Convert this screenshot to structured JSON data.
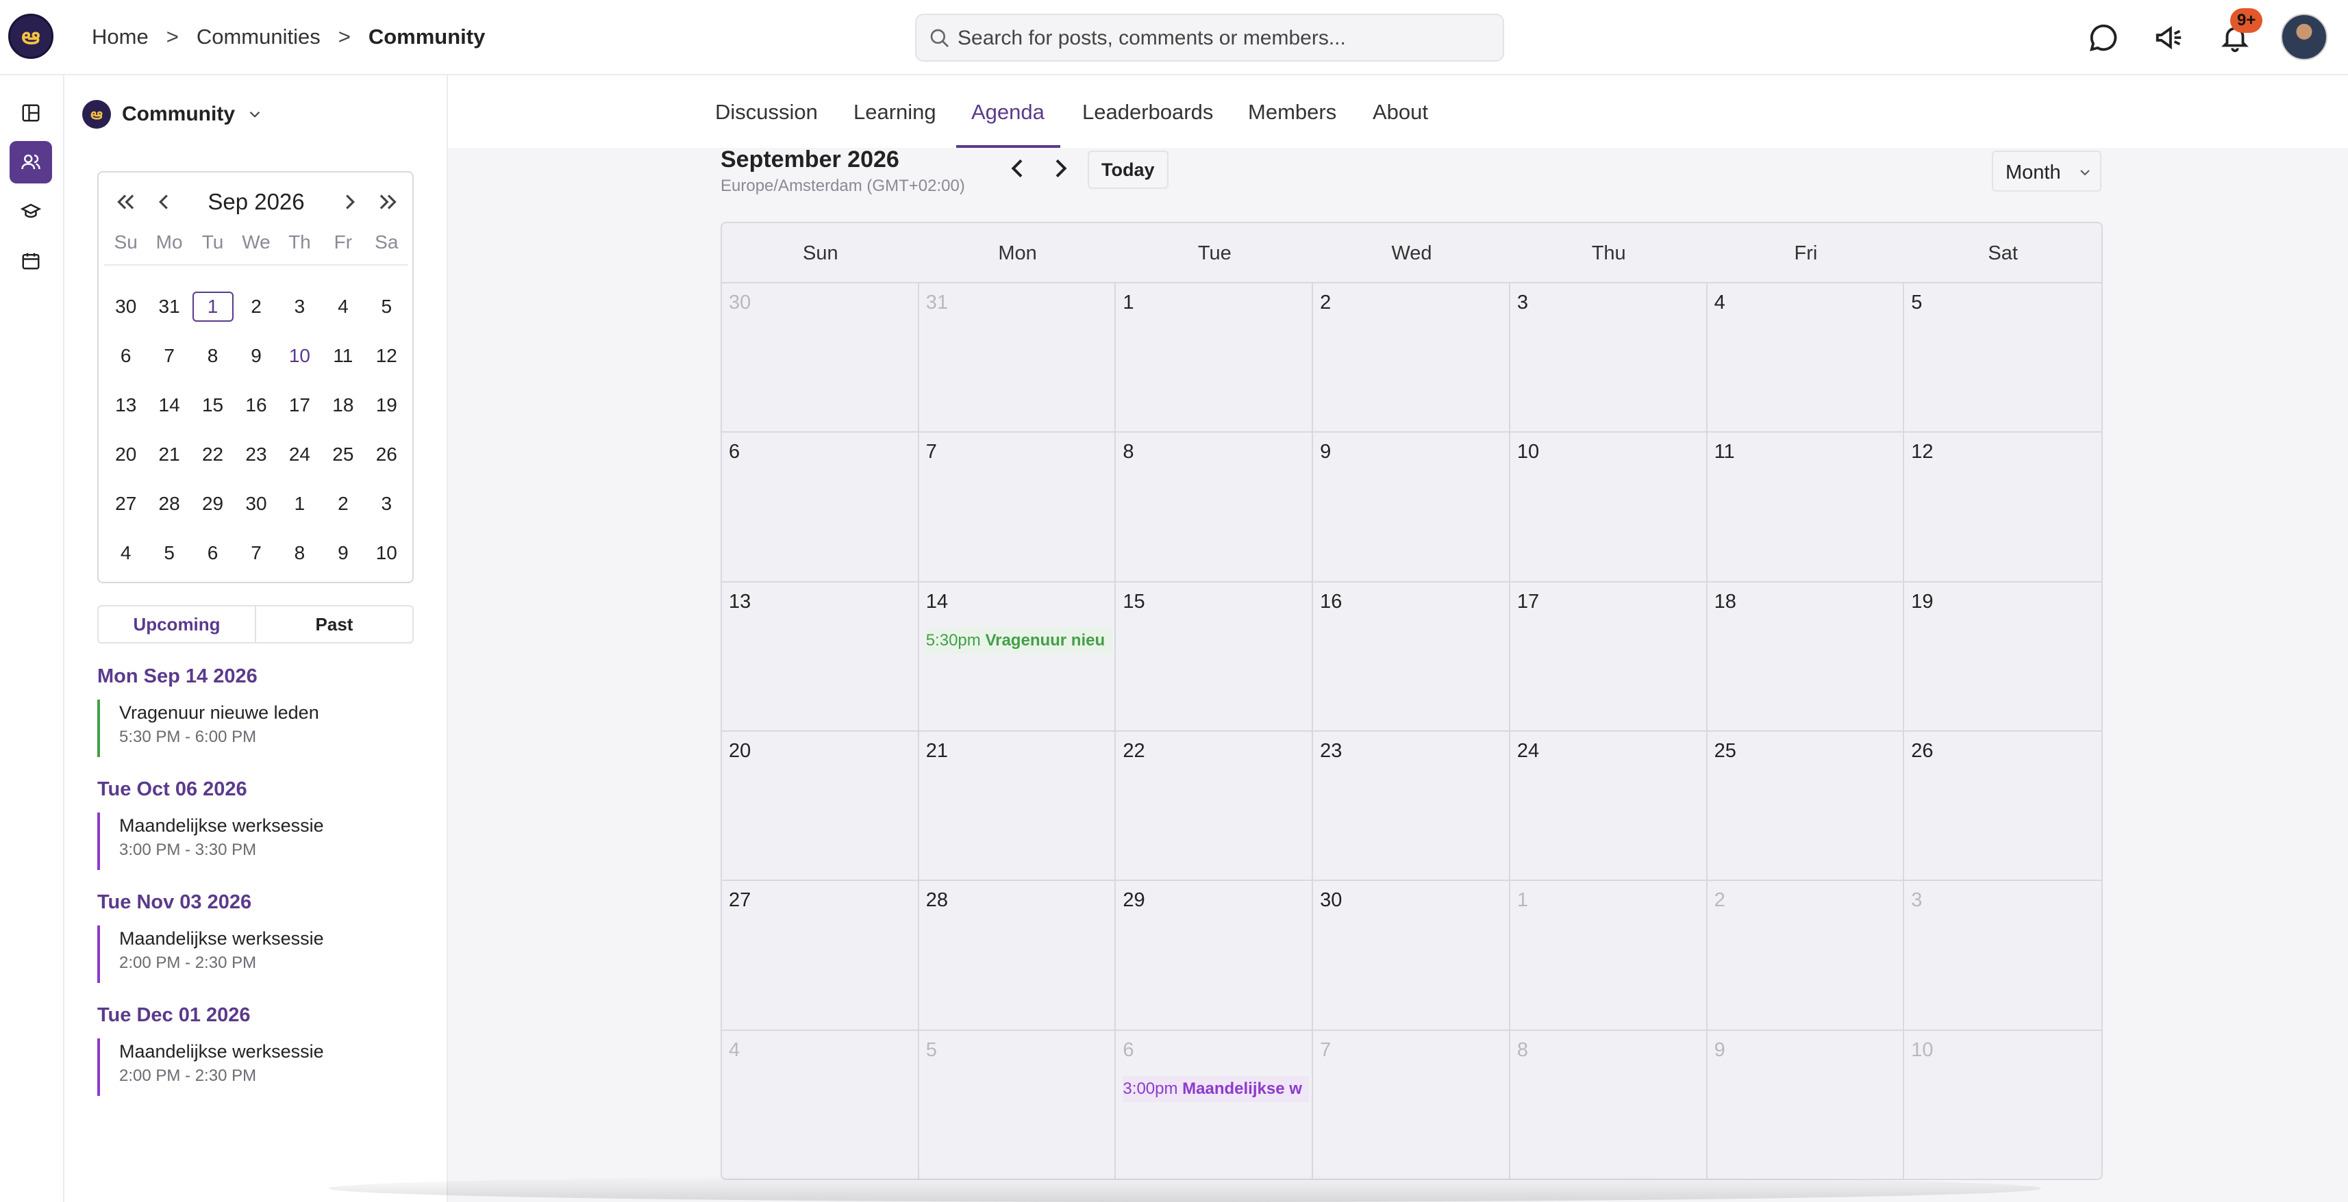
{
  "breadcrumb": {
    "home": "Home",
    "sep": ">",
    "communities": "Communities",
    "current": "Community"
  },
  "search": {
    "placeholder": "Search for posts, comments or members..."
  },
  "notifications": {
    "badge": "9+"
  },
  "sidebar": {
    "community_name": "Community",
    "mini_calendar": {
      "title": "Sep 2026",
      "weekdays": [
        "Su",
        "Mo",
        "Tu",
        "We",
        "Th",
        "Fr",
        "Sa"
      ],
      "days": [
        "30",
        "31",
        "1",
        "2",
        "3",
        "4",
        "5",
        "6",
        "7",
        "8",
        "9",
        "10",
        "11",
        "12",
        "13",
        "14",
        "15",
        "16",
        "17",
        "18",
        "19",
        "20",
        "21",
        "22",
        "23",
        "24",
        "25",
        "26",
        "27",
        "28",
        "29",
        "30",
        "1",
        "2",
        "3",
        "4",
        "5",
        "6",
        "7",
        "8",
        "9",
        "10"
      ],
      "selected_day": "1",
      "today_day": "10"
    },
    "toggle": {
      "upcoming": "Upcoming",
      "past": "Past"
    },
    "events": [
      {
        "date": "Mon Sep 14 2026",
        "name": "Vragenuur nieuwe leden",
        "time": "5:30 PM - 6:00 PM",
        "color": "#43a047"
      },
      {
        "date": "Tue Oct 06 2026",
        "name": "Maandelijkse werksessie",
        "time": "3:00 PM - 3:30 PM",
        "color": "#8e3acd"
      },
      {
        "date": "Tue Nov 03 2026",
        "name": "Maandelijkse werksessie",
        "time": "2:00 PM - 2:30 PM",
        "color": "#8e3acd"
      },
      {
        "date": "Tue Dec 01 2026",
        "name": "Maandelijkse werksessie",
        "time": "2:00 PM - 2:30 PM",
        "color": "#8e3acd"
      }
    ]
  },
  "tabs": [
    "Discussion",
    "Learning",
    "Agenda",
    "Leaderboards",
    "Members",
    "About"
  ],
  "active_tab": "Agenda",
  "calendar": {
    "month_title": "September 2026",
    "timezone": "Europe/Amsterdam (GMT+02:00)",
    "today_label": "Today",
    "view": "Month",
    "weekdays": [
      "Sun",
      "Mon",
      "Tue",
      "Wed",
      "Thu",
      "Fri",
      "Sat"
    ],
    "cells": [
      {
        "d": "30",
        "m": true
      },
      {
        "d": "31",
        "m": true
      },
      {
        "d": "1"
      },
      {
        "d": "2"
      },
      {
        "d": "3"
      },
      {
        "d": "4"
      },
      {
        "d": "5"
      },
      {
        "d": "6"
      },
      {
        "d": "7"
      },
      {
        "d": "8"
      },
      {
        "d": "9"
      },
      {
        "d": "10"
      },
      {
        "d": "11"
      },
      {
        "d": "12"
      },
      {
        "d": "13"
      },
      {
        "d": "14",
        "event": {
          "time": "5:30pm",
          "title": "Vragenuur nieu",
          "color": "green"
        }
      },
      {
        "d": "15"
      },
      {
        "d": "16"
      },
      {
        "d": "17"
      },
      {
        "d": "18"
      },
      {
        "d": "19"
      },
      {
        "d": "20"
      },
      {
        "d": "21"
      },
      {
        "d": "22"
      },
      {
        "d": "23"
      },
      {
        "d": "24"
      },
      {
        "d": "25"
      },
      {
        "d": "26"
      },
      {
        "d": "27"
      },
      {
        "d": "28"
      },
      {
        "d": "29"
      },
      {
        "d": "30"
      },
      {
        "d": "1",
        "m": true
      },
      {
        "d": "2",
        "m": true
      },
      {
        "d": "3",
        "m": true
      },
      {
        "d": "4",
        "m": true
      },
      {
        "d": "5",
        "m": true
      },
      {
        "d": "6",
        "m": true,
        "event": {
          "time": "3:00pm",
          "title": "Maandelijkse w",
          "color": "purple"
        }
      },
      {
        "d": "7",
        "m": true
      },
      {
        "d": "8",
        "m": true
      },
      {
        "d": "9",
        "m": true
      },
      {
        "d": "10",
        "m": true
      }
    ]
  }
}
